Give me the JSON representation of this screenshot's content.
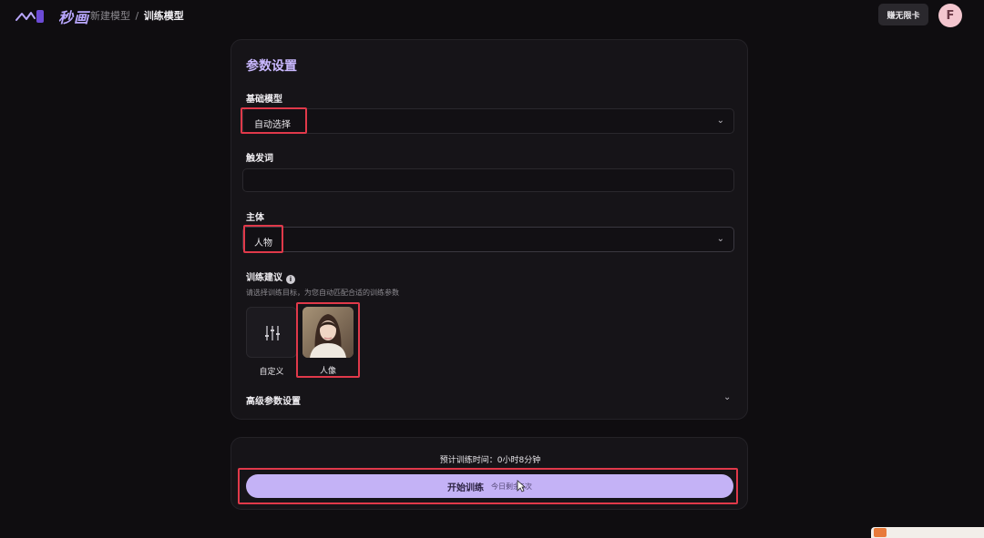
{
  "header": {
    "brand": "秒画",
    "breadcrumb_parent": "新建模型",
    "breadcrumb_sep": "/",
    "breadcrumb_current": "训练模型",
    "card_button": "赚无限卡",
    "avatar_initial": "F"
  },
  "params": {
    "title": "参数设置",
    "base_model_label": "基础模型",
    "base_model_value": "自动选择",
    "trigger_label": "触发词",
    "trigger_value": "",
    "subject_label": "主体",
    "subject_value": "人物",
    "suggestion_label": "训练建议",
    "info_icon_glyph": "i",
    "suggestion_hint": "请选择训练目标，为您自动匹配合适的训练参数",
    "options": [
      {
        "label": "自定义",
        "icon": "sliders-icon"
      },
      {
        "label": "人像",
        "icon": "portrait-thumbnail"
      }
    ],
    "advanced_label": "高级参数设置"
  },
  "footer": {
    "estimate": "预计训练时间：0小时8分钟",
    "train_button": "开始训练",
    "train_sub": "今日剩余5次"
  },
  "colors": {
    "accent": "#c4b2f6",
    "highlight": "#e0394a",
    "background": "#0f0d10",
    "panel": "#161418"
  }
}
